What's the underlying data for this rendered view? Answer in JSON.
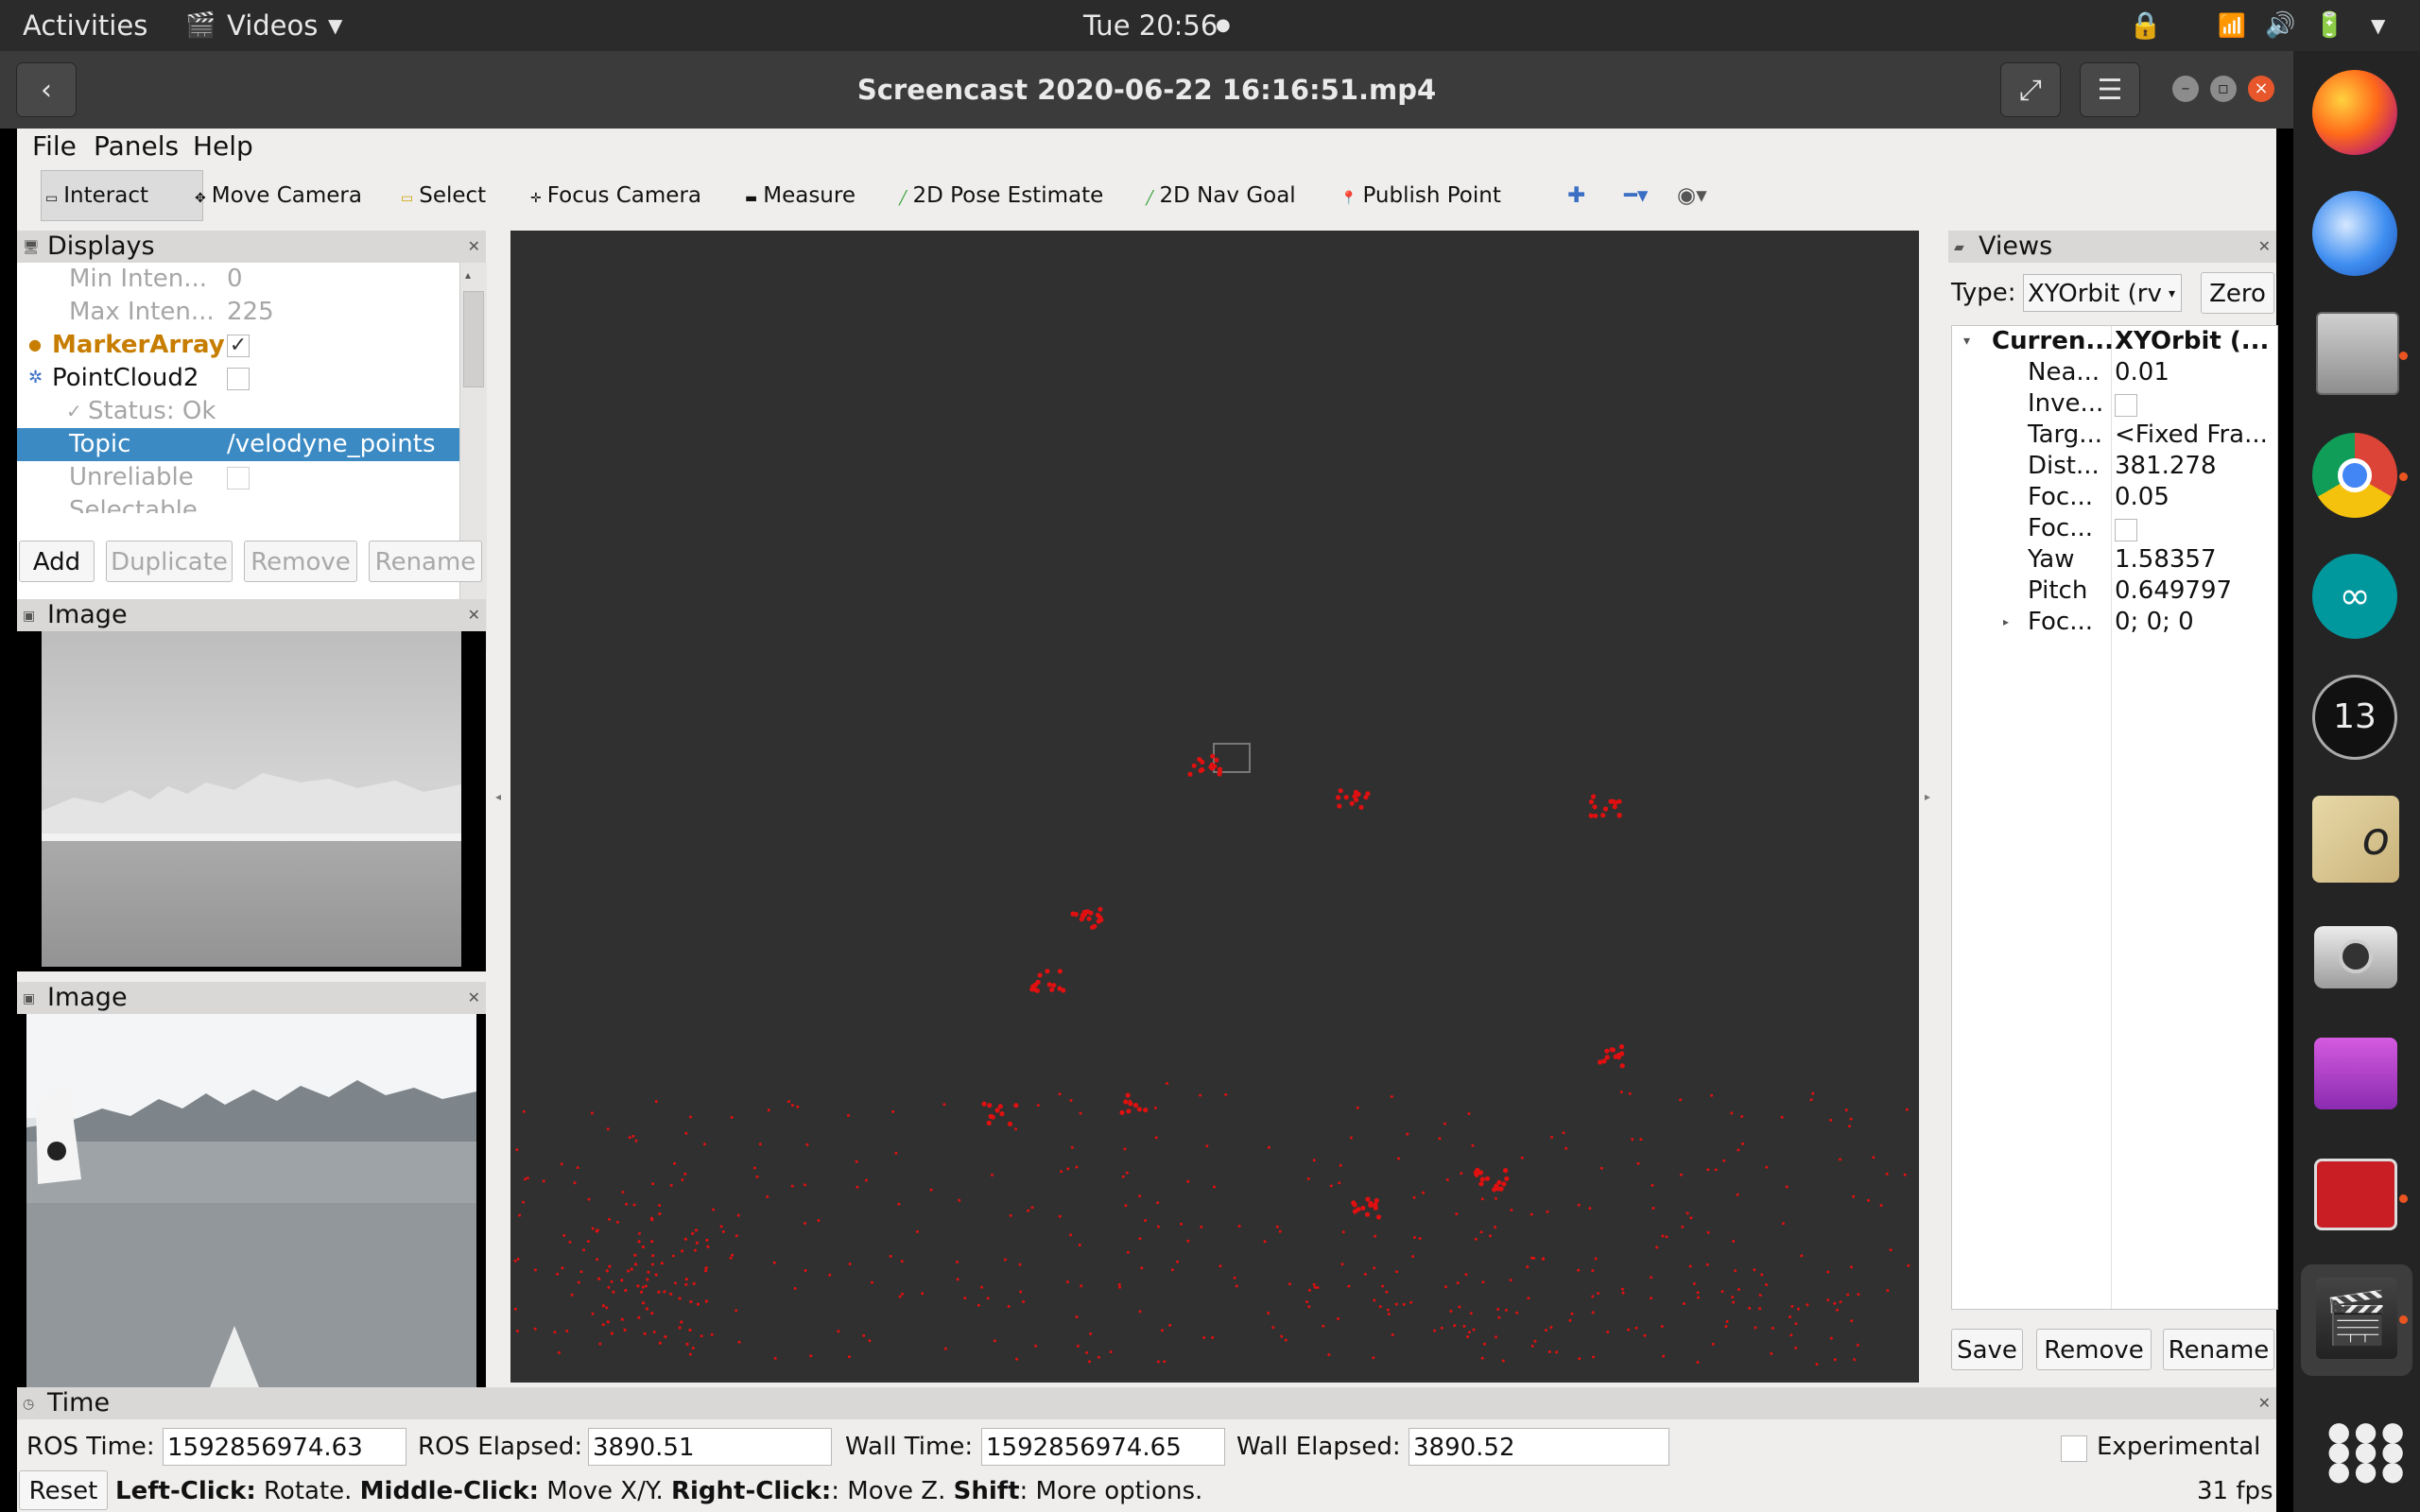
{
  "topbar": {
    "activities": "Activities",
    "app_name": "Videos",
    "clock": "Tue 20:56"
  },
  "player": {
    "title": "Screencast 2020-06-22 16:16:51.mp4"
  },
  "rviz": {
    "menu": [
      "File",
      "Panels",
      "Help"
    ],
    "tools": [
      {
        "label": "Interact",
        "icon": "interact-icon"
      },
      {
        "label": "Move Camera",
        "icon": "move-camera-icon"
      },
      {
        "label": "Select",
        "icon": "select-icon"
      },
      {
        "label": "Focus Camera",
        "icon": "focus-camera-icon"
      },
      {
        "label": "Measure",
        "icon": "measure-icon"
      },
      {
        "label": "2D Pose Estimate",
        "icon": "pose-estimate-icon"
      },
      {
        "label": "2D Nav Goal",
        "icon": "nav-goal-icon"
      },
      {
        "label": "Publish Point",
        "icon": "publish-point-icon"
      }
    ],
    "displays": {
      "title": "Displays",
      "rows": [
        {
          "name": "Min Inten...",
          "value": "0"
        },
        {
          "name": "Max Inten...",
          "value": "225"
        },
        {
          "name": "MarkerArray",
          "value": "✓"
        },
        {
          "name": "PointCloud2",
          "value": ""
        },
        {
          "name": "Status: Ok",
          "value": ""
        },
        {
          "name": "Topic",
          "value": "/velodyne_points"
        },
        {
          "name": "Unreliable",
          "value": ""
        },
        {
          "name": "Selectable",
          "value": "✓"
        }
      ],
      "buttons": {
        "add": "Add",
        "duplicate": "Duplicate",
        "remove": "Remove",
        "rename": "Rename"
      }
    },
    "image_panel_1": {
      "title": "Image"
    },
    "image_panel_2": {
      "title": "Image"
    },
    "views": {
      "title": "Views",
      "type_label": "Type:",
      "type_value": "XYOrbit (rv",
      "zero": "Zero",
      "rows": [
        {
          "name": "Curren...",
          "value": "XYOrbit (..."
        },
        {
          "name": "Nea...",
          "value": "0.01"
        },
        {
          "name": "Inve...",
          "value": ""
        },
        {
          "name": "Targ...",
          "value": "<Fixed Fra..."
        },
        {
          "name": "Dist...",
          "value": "381.278"
        },
        {
          "name": "Foc...",
          "value": "0.05"
        },
        {
          "name": "Foc...",
          "value": ""
        },
        {
          "name": "Yaw",
          "value": "1.58357"
        },
        {
          "name": "Pitch",
          "value": "0.649797"
        },
        {
          "name": "Foc...",
          "value": "0; 0; 0"
        }
      ],
      "buttons": {
        "save": "Save",
        "remove": "Remove",
        "rename": "Rename"
      }
    },
    "time": {
      "title": "Time",
      "ros_time_label": "ROS Time:",
      "ros_time": "1592856974.63",
      "ros_elapsed_label": "ROS Elapsed:",
      "ros_elapsed": "3890.51",
      "wall_time_label": "Wall Time:",
      "wall_time": "1592856974.65",
      "wall_elapsed_label": "Wall Elapsed:",
      "wall_elapsed": "3890.52",
      "experimental": "Experimental"
    },
    "status": {
      "reset": "Reset",
      "k1": "Left-Click:",
      "t1": " Rotate. ",
      "k2": "Middle-Click:",
      "t2": " Move X/Y. ",
      "k3": "Right-Click:",
      "t3": ": Move Z. ",
      "k4": "Shift",
      "t4": ": More options.",
      "fps": "31 fps"
    }
  },
  "dock": [
    "firefox-icon",
    "thunderbird-icon",
    "files-icon",
    "chrome-icon",
    "arduino-icon",
    "app-13-icon",
    "map-icon",
    "camera-icon",
    "screen-recorder-icon",
    "presentation-icon",
    "videos-icon",
    "show-apps-icon"
  ],
  "colors": {
    "point_cloud": "#e01010",
    "viewport_bg": "#303030",
    "selection": "#3b8ac4",
    "marker_orange": "#c77d00"
  }
}
